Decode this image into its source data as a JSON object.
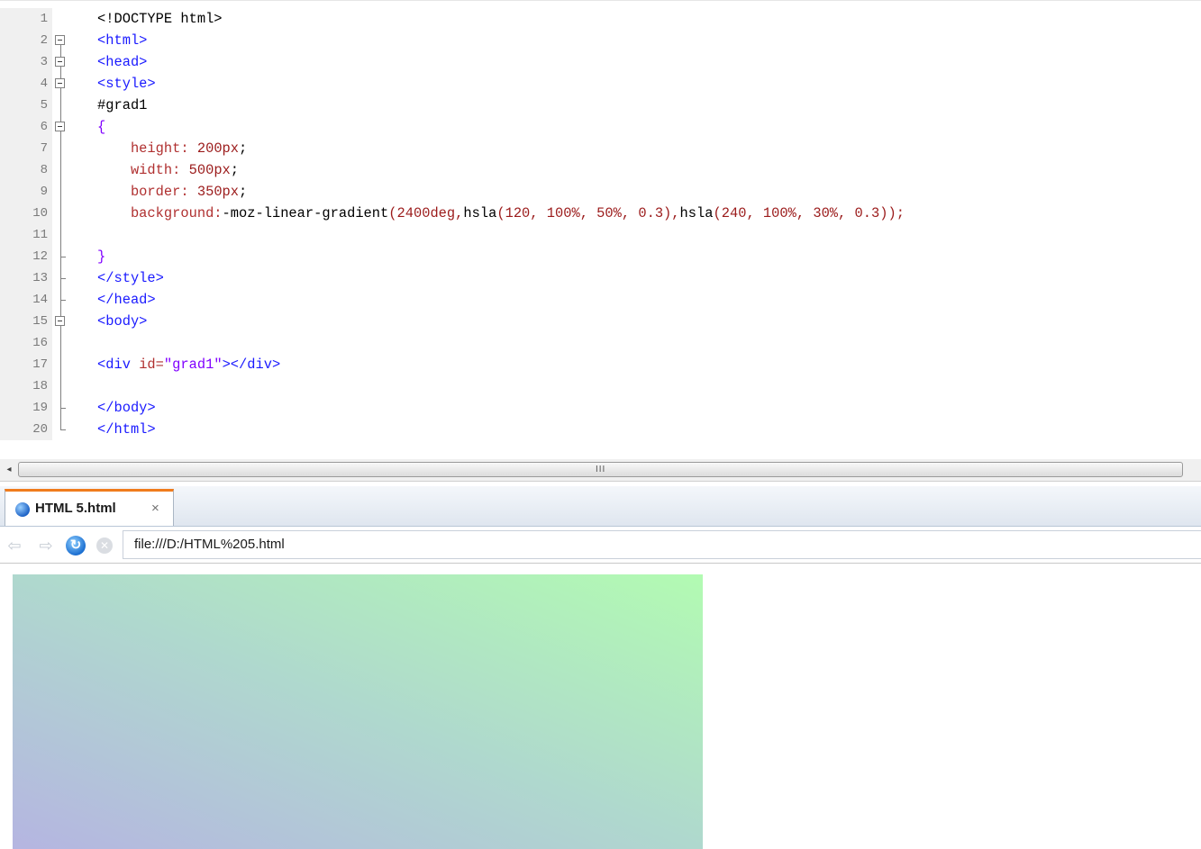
{
  "editor": {
    "lines": [
      {
        "num": "1",
        "fold": "none",
        "parts": [
          {
            "t": "<!DOCTYPE html>",
            "c": "black"
          }
        ]
      },
      {
        "num": "2",
        "fold": "open",
        "parts": [
          {
            "t": "<html>",
            "c": "blue"
          }
        ]
      },
      {
        "num": "3",
        "fold": "open",
        "parts": [
          {
            "t": "<head>",
            "c": "blue"
          }
        ]
      },
      {
        "num": "4",
        "fold": "open",
        "parts": [
          {
            "t": "<style>",
            "c": "blue"
          }
        ]
      },
      {
        "num": "5",
        "fold": "line",
        "parts": [
          {
            "t": "#grad1",
            "c": "black"
          }
        ]
      },
      {
        "num": "6",
        "fold": "open",
        "parts": [
          {
            "t": "{",
            "c": "purple"
          }
        ]
      },
      {
        "num": "7",
        "fold": "line",
        "parts": [
          {
            "t": "    height: ",
            "c": "red"
          },
          {
            "t": "200px",
            "c": "dred"
          },
          {
            "t": ";",
            "c": "black"
          }
        ]
      },
      {
        "num": "8",
        "fold": "line",
        "parts": [
          {
            "t": "    width: ",
            "c": "red"
          },
          {
            "t": "500px",
            "c": "dred"
          },
          {
            "t": ";",
            "c": "black"
          }
        ]
      },
      {
        "num": "9",
        "fold": "line",
        "parts": [
          {
            "t": "    border: ",
            "c": "red"
          },
          {
            "t": "350px",
            "c": "dred"
          },
          {
            "t": ";",
            "c": "black"
          }
        ]
      },
      {
        "num": "10",
        "fold": "line",
        "parts": [
          {
            "t": "    background:",
            "c": "red"
          },
          {
            "t": "-moz-linear-gradient",
            "c": "black"
          },
          {
            "t": "(2400deg,",
            "c": "dred"
          },
          {
            "t": "hsla",
            "c": "black"
          },
          {
            "t": "(120, 100%, 50%, 0.3),",
            "c": "dred"
          },
          {
            "t": "hsla",
            "c": "black"
          },
          {
            "t": "(240, 100%, 30%, 0.3));",
            "c": "dred"
          }
        ]
      },
      {
        "num": "11",
        "fold": "line",
        "parts": []
      },
      {
        "num": "12",
        "fold": "end",
        "parts": [
          {
            "t": "}",
            "c": "purple"
          }
        ]
      },
      {
        "num": "13",
        "fold": "end",
        "parts": [
          {
            "t": "</style>",
            "c": "blue"
          }
        ]
      },
      {
        "num": "14",
        "fold": "end",
        "parts": [
          {
            "t": "</head>",
            "c": "blue"
          }
        ]
      },
      {
        "num": "15",
        "fold": "open",
        "parts": [
          {
            "t": "<body>",
            "c": "blue"
          }
        ]
      },
      {
        "num": "16",
        "fold": "line",
        "parts": []
      },
      {
        "num": "17",
        "fold": "line",
        "parts": [
          {
            "t": "<div ",
            "c": "blue"
          },
          {
            "t": "id=",
            "c": "red"
          },
          {
            "t": "\"grad1\"",
            "c": "purple"
          },
          {
            "t": "></div>",
            "c": "blue"
          }
        ]
      },
      {
        "num": "18",
        "fold": "line",
        "parts": []
      },
      {
        "num": "19",
        "fold": "end",
        "parts": [
          {
            "t": "</body>",
            "c": "blue"
          }
        ]
      },
      {
        "num": "20",
        "fold": "last",
        "parts": [
          {
            "t": "</html>",
            "c": "blue"
          }
        ]
      }
    ]
  },
  "scrollbar": {
    "left_arrow": "◂",
    "grip": "III"
  },
  "browser": {
    "tab": {
      "title": "HTML 5.html",
      "close": "×",
      "icon": "globe-icon"
    },
    "nav": {
      "back": "⇦",
      "forward": "⇨",
      "reload": "↻",
      "stop": "✕"
    },
    "address": "file:///D:/HTML%205.html"
  },
  "colors": {
    "gradient_start": "#b5b5e1",
    "gradient_end": "#b2fbb2",
    "tab_accent": "#f07c1d"
  }
}
